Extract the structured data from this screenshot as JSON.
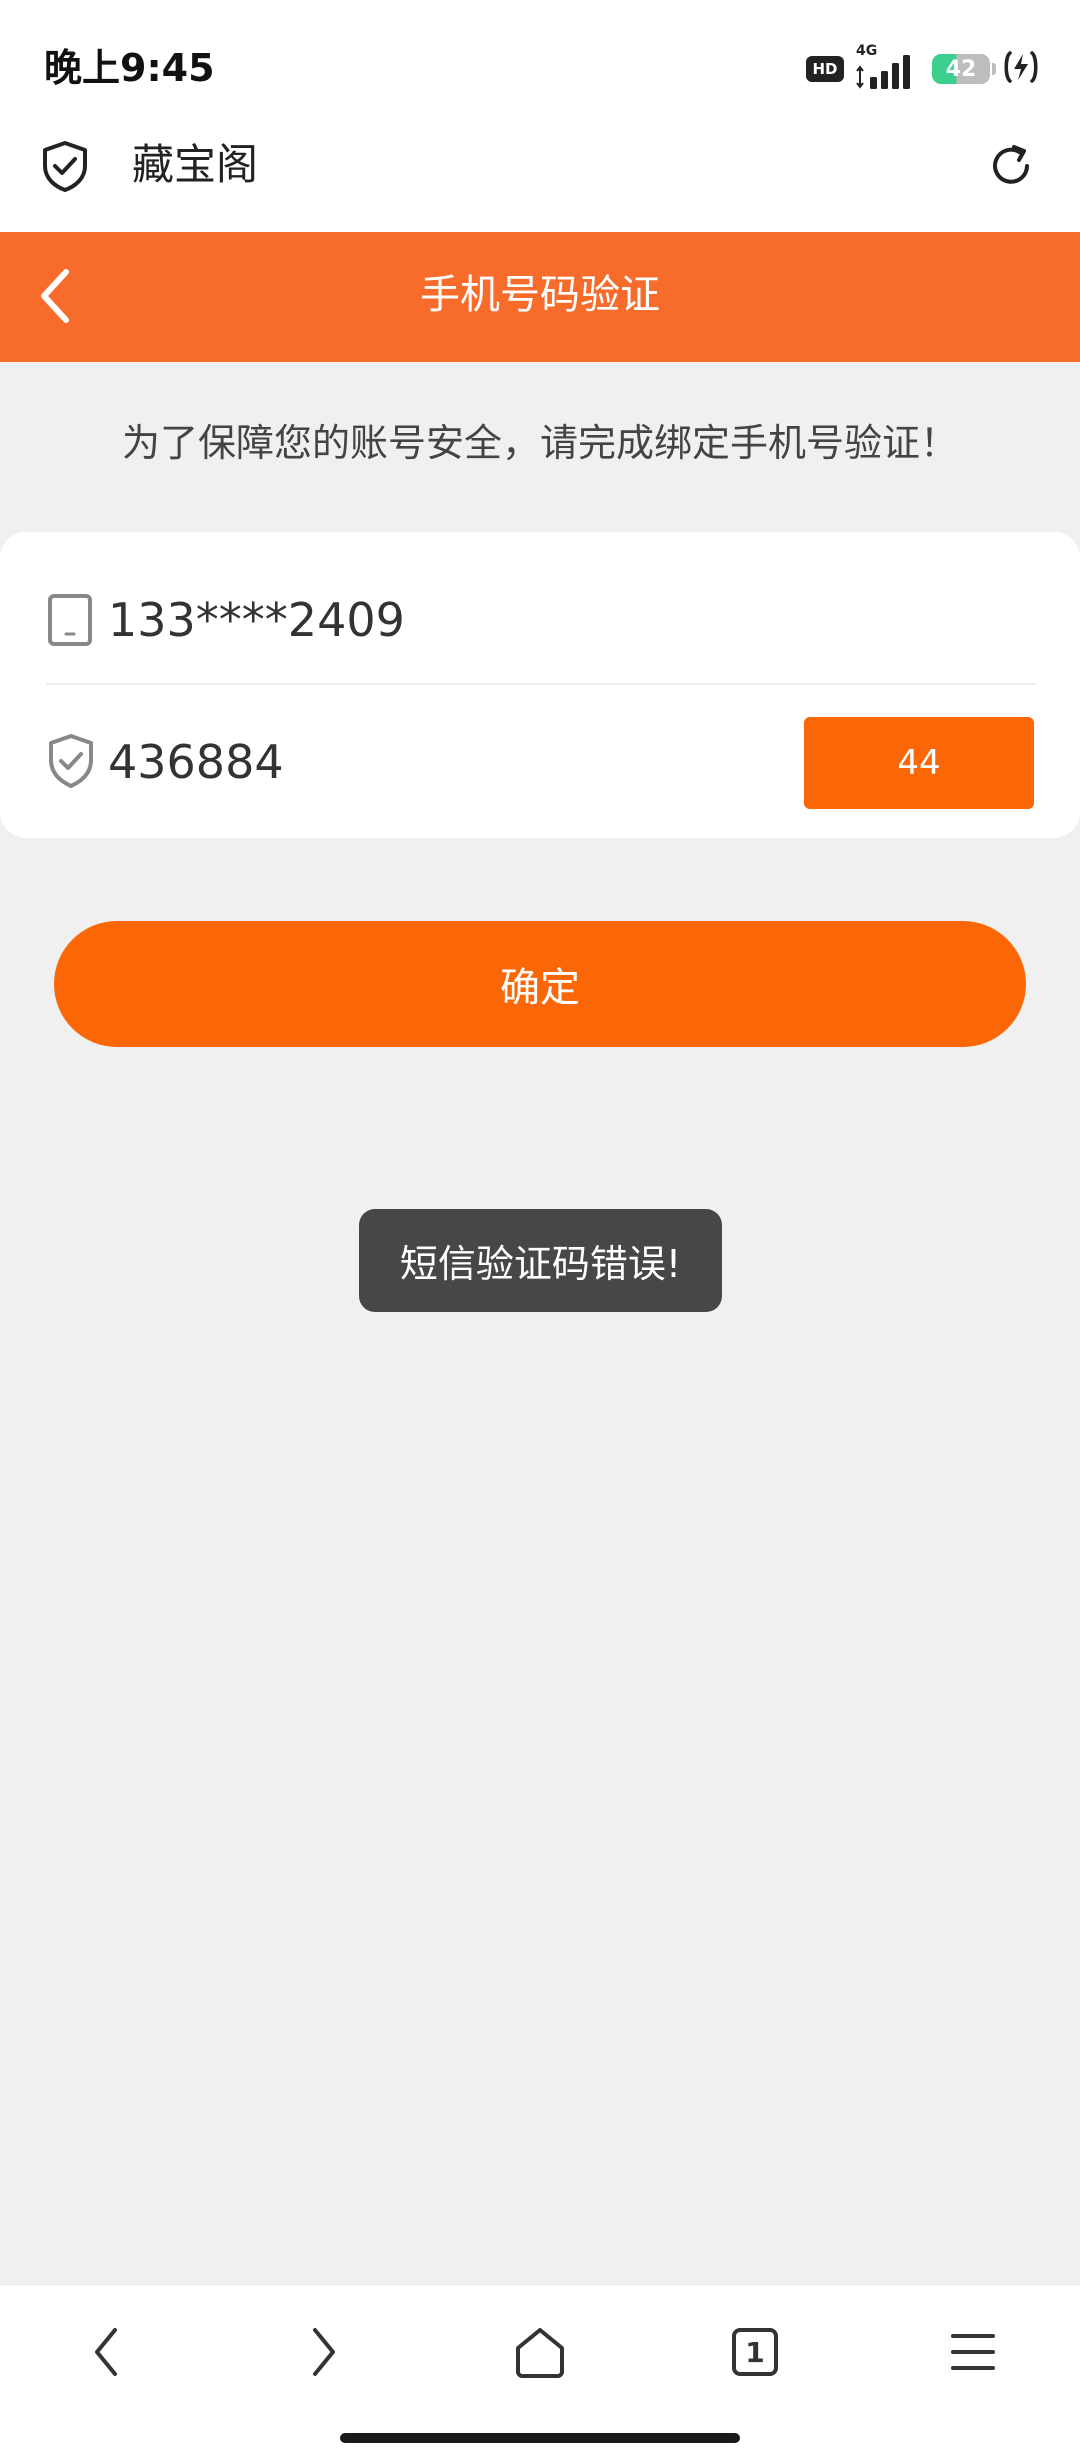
{
  "status_bar": {
    "time": "晚上9:45",
    "hd_label": "HD",
    "network_label": "4G",
    "battery_level": "42",
    "icons": [
      "signal-icon",
      "battery-icon",
      "charging-icon"
    ]
  },
  "browser_bar": {
    "site_title": "藏宝阁",
    "icons": [
      "shield-check-icon",
      "refresh-icon"
    ]
  },
  "header": {
    "title": "手机号码验证",
    "back_icon": "chevron-left-icon"
  },
  "notice": "为了保障您的账号安全，请完成绑定手机号验证！",
  "form": {
    "phone_value": "133****2409",
    "code_value": "436884",
    "countdown_label": "44",
    "icons": [
      "phone-icon",
      "shield-check-icon"
    ]
  },
  "confirm_label": "确定",
  "toast_message": "短信验证码错误!",
  "bottom_nav": {
    "tab_count": "1",
    "items": [
      "back-icon",
      "forward-icon",
      "home-icon",
      "tabs-icon",
      "menu-icon"
    ]
  },
  "colors": {
    "header_orange": "#f76b2b",
    "button_orange": "#fb6607",
    "toast_bg": "#474747",
    "page_bg": "#f0f0f0"
  }
}
